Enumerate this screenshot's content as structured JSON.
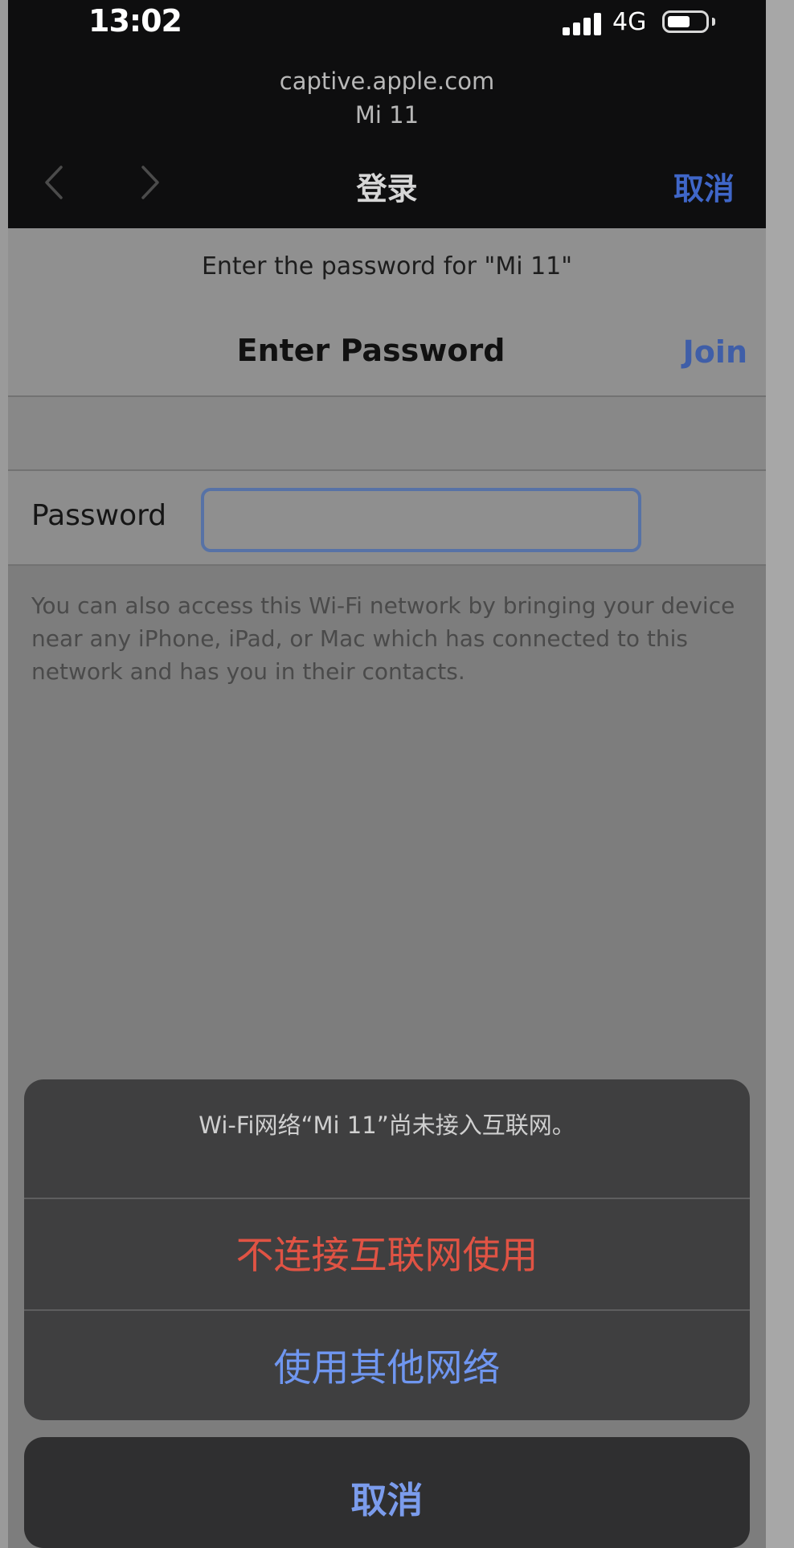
{
  "status_bar": {
    "time": "13:02",
    "network": "4G"
  },
  "browser": {
    "domain": "captive.apple.com",
    "ssid": "Mi 11",
    "title": "登录",
    "cancel_label": "取消"
  },
  "prompt": {
    "message": "Enter the password for \"Mi 11\"",
    "title": "Enter Password",
    "join_label": "Join"
  },
  "password": {
    "label": "Password",
    "value": "",
    "placeholder": ""
  },
  "info": {
    "text": "You can also access this Wi-Fi network by bringing your device near any iPhone, iPad, or Mac which has connected to this network and has you in their contacts."
  },
  "action_sheet": {
    "message": "Wi-Fi网络“Mi 11”尚未接入互联网。",
    "option_1": "不连接互联网使用",
    "option_2": "使用其他网络",
    "cancel": "取消"
  },
  "colors": {
    "accent_blue": "#3f66c8",
    "destructive_red": "#e05344",
    "sheet_blue": "#6f96f0"
  },
  "icons": {
    "back": "chevron-left-icon",
    "forward": "chevron-right-icon",
    "signal": "signal-icon",
    "battery": "battery-icon"
  }
}
